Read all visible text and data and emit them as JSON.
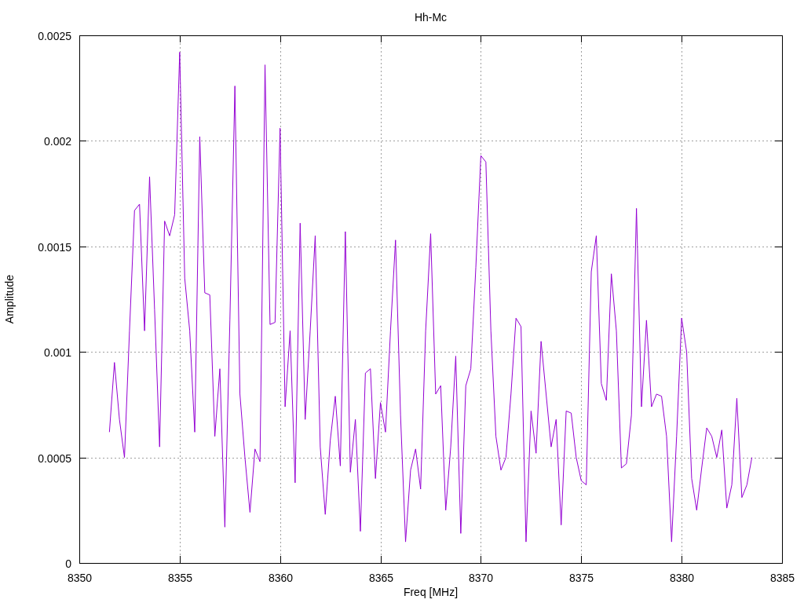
{
  "chart_data": {
    "type": "line",
    "grid": true,
    "title": "Hh-Mc",
    "xlabel": "Freq [MHz]",
    "ylabel": "Amplitude",
    "xlim": [
      8350,
      8385
    ],
    "ylim": [
      0,
      0.0025
    ],
    "xticks": [
      {
        "value": 8350,
        "label": "8350"
      },
      {
        "value": 8355,
        "label": "8355"
      },
      {
        "value": 8360,
        "label": "8360"
      },
      {
        "value": 8365,
        "label": "8365"
      },
      {
        "value": 8370,
        "label": "8370"
      },
      {
        "value": 8375,
        "label": "8375"
      },
      {
        "value": 8380,
        "label": "8380"
      },
      {
        "value": 8385,
        "label": "8385"
      }
    ],
    "yticks": [
      {
        "value": 0,
        "label": "0"
      },
      {
        "value": 0.0005,
        "label": "0.0005"
      },
      {
        "value": 0.001,
        "label": "0.001"
      },
      {
        "value": 0.0015,
        "label": "0.0015"
      },
      {
        "value": 0.002,
        "label": "0.002"
      },
      {
        "value": 0.0025,
        "label": "0.0025"
      }
    ],
    "x": [
      8351.5,
      8351.75,
      8352,
      8352.25,
      8352.5,
      8352.75,
      8353,
      8353.25,
      8353.5,
      8353.75,
      8354,
      8354.25,
      8354.5,
      8354.75,
      8355,
      8355.25,
      8355.5,
      8355.75,
      8356,
      8356.25,
      8356.5,
      8356.75,
      8357,
      8357.25,
      8357.5,
      8357.75,
      8358,
      8358.25,
      8358.5,
      8358.75,
      8359,
      8359.25,
      8359.5,
      8359.75,
      8360,
      8360.25,
      8360.5,
      8360.75,
      8361,
      8361.25,
      8361.5,
      8361.75,
      8362,
      8362.25,
      8362.5,
      8362.75,
      8363,
      8363.25,
      8363.5,
      8363.75,
      8364,
      8364.25,
      8364.5,
      8364.75,
      8365,
      8365.25,
      8365.5,
      8365.75,
      8366,
      8366.25,
      8366.5,
      8366.75,
      8367,
      8367.25,
      8367.5,
      8367.75,
      8368,
      8368.25,
      8368.5,
      8368.75,
      8369,
      8369.25,
      8369.5,
      8369.75,
      8370,
      8370.25,
      8370.5,
      8370.75,
      8371,
      8371.25,
      8371.5,
      8371.75,
      8372,
      8372.25,
      8372.5,
      8372.75,
      8373,
      8373.25,
      8373.5,
      8373.75,
      8374,
      8374.25,
      8374.5,
      8374.75,
      8375,
      8375.25,
      8375.5,
      8375.75,
      8376,
      8376.25,
      8376.5,
      8376.75,
      8377,
      8377.25,
      8377.5,
      8377.75,
      8378,
      8378.25,
      8378.5,
      8378.75,
      8379,
      8379.25,
      8379.5,
      8379.75,
      8380,
      8380.25,
      8380.5,
      8380.75,
      8381,
      8381.25,
      8381.5,
      8381.75,
      8382,
      8382.25,
      8382.5,
      8382.75,
      8383,
      8383.25,
      8383.5
    ],
    "series": [
      {
        "color": "#9400d3",
        "values": [
          0.00062,
          0.00095,
          0.00068,
          0.0005,
          0.0011,
          0.00167,
          0.0017,
          0.0011,
          0.00183,
          0.0012,
          0.00055,
          0.00162,
          0.00155,
          0.00165,
          0.00242,
          0.00135,
          0.0011,
          0.00062,
          0.00202,
          0.00128,
          0.00127,
          0.0006,
          0.00092,
          0.00017,
          0.00115,
          0.00226,
          0.0008,
          0.0005,
          0.00024,
          0.00054,
          0.00048,
          0.00236,
          0.00113,
          0.00114,
          0.00206,
          0.00074,
          0.0011,
          0.00038,
          0.00161,
          0.00068,
          0.0011,
          0.00155,
          0.00055,
          0.00023,
          0.00058,
          0.00079,
          0.00046,
          0.00157,
          0.00043,
          0.00068,
          0.00015,
          0.0009,
          0.00092,
          0.0004,
          0.00076,
          0.00062,
          0.0011,
          0.00153,
          0.0007,
          0.0001,
          0.00044,
          0.00054,
          0.00035,
          0.0011,
          0.00156,
          0.0008,
          0.00084,
          0.00025,
          0.00055,
          0.00098,
          0.00014,
          0.00084,
          0.00092,
          0.0014,
          0.00193,
          0.0019,
          0.0011,
          0.0006,
          0.00044,
          0.0005,
          0.0008,
          0.00116,
          0.00112,
          0.0001,
          0.00072,
          0.00052,
          0.00105,
          0.0008,
          0.00055,
          0.00068,
          0.00018,
          0.00072,
          0.00071,
          0.0005,
          0.00039,
          0.00037,
          0.00138,
          0.00155,
          0.00085,
          0.00077,
          0.00137,
          0.0011,
          0.00045,
          0.00047,
          0.0007,
          0.00168,
          0.00074,
          0.00115,
          0.00074,
          0.0008,
          0.00079,
          0.0006,
          0.0001,
          0.0006,
          0.00116,
          0.001,
          0.0004,
          0.00025,
          0.00045,
          0.00064,
          0.0006,
          0.0005,
          0.00063,
          0.00026,
          0.00037,
          0.00078,
          0.00031,
          0.00037,
          0.0005
        ]
      }
    ]
  }
}
